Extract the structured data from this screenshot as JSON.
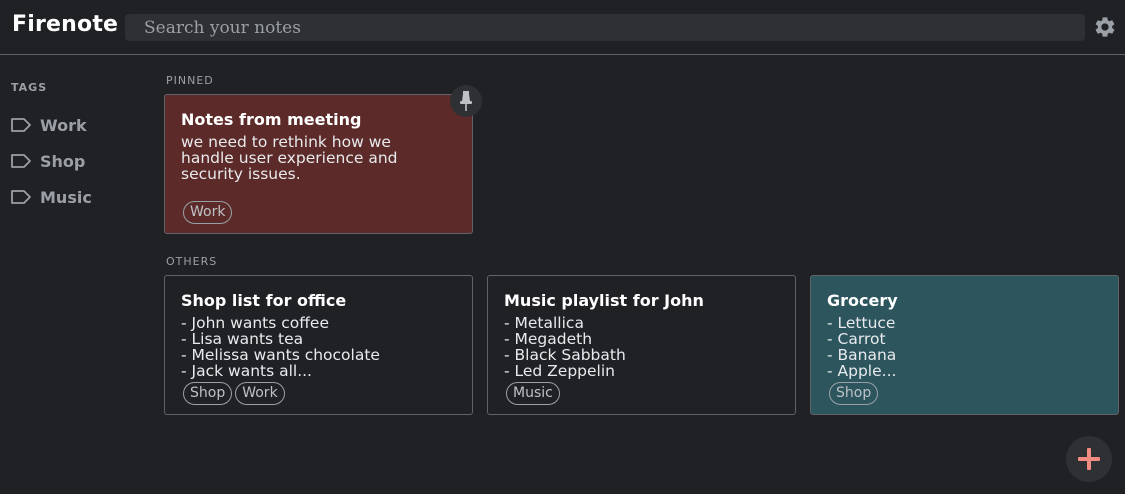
{
  "app": {
    "title": "Firenote"
  },
  "search": {
    "placeholder": "Search your notes"
  },
  "sidebar": {
    "heading": "TAGS",
    "items": [
      {
        "label": "Work"
      },
      {
        "label": "Shop"
      },
      {
        "label": "Music"
      }
    ]
  },
  "sections": {
    "pinned": "PINNED",
    "others": "OTHERS"
  },
  "notes": {
    "pinned": [
      {
        "title": "Notes from meeting",
        "body": "we need to rethink how we\nhandle user experience and\nsecurity issues.",
        "tags": [
          "Work"
        ],
        "color": "#5c2b29"
      }
    ],
    "others": [
      {
        "title": "Shop list for office",
        "body": "- John wants coffee\n- Lisa wants tea\n- Melissa wants chocolate\n- Jack wants all...",
        "tags": [
          "Shop",
          "Work"
        ],
        "color": "#202124"
      },
      {
        "title": "Music playlist for John",
        "body": "- Metallica\n- Megadeth\n- Black Sabbath\n- Led Zeppelin",
        "tags": [
          "Music"
        ],
        "color": "#202124"
      },
      {
        "title": "Grocery",
        "body": "- Lettuce\n- Carrot\n- Banana\n- Apple...",
        "tags": [
          "Shop"
        ],
        "color": "#2d555e"
      }
    ]
  },
  "icons": {
    "settings": "gear-icon",
    "tag": "label-icon",
    "pin": "pin-icon",
    "add": "plus-icon"
  },
  "colors": {
    "fab_plus": "#f28b82"
  }
}
